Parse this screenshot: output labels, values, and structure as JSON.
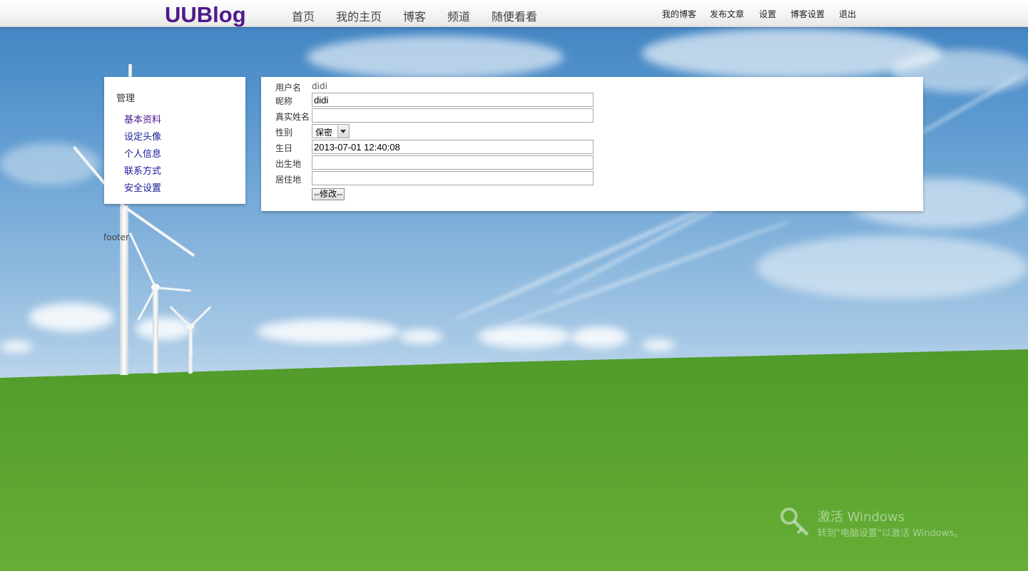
{
  "header": {
    "logo": "UUBlog",
    "main_nav": [
      "首页",
      "我的主页",
      "博客",
      "频道",
      "随便看看"
    ],
    "user_nav": [
      "我的博客",
      "发布文章",
      "设置",
      "博客设置",
      "退出"
    ]
  },
  "sidebar": {
    "title": "管理",
    "items": [
      "基本资料",
      "设定头像",
      "个人信息",
      "联系方式",
      "安全设置"
    ]
  },
  "form": {
    "username_label": "用户名",
    "username_value": "didi",
    "nickname_label": "昵称",
    "nickname_value": "didi",
    "realname_label": "真实姓名",
    "realname_value": "",
    "gender_label": "性别",
    "gender_selected": "保密",
    "birthday_label": "生日",
    "birthday_value": "2013-07-01 12:40:08",
    "birthplace_label": "出生地",
    "birthplace_value": "",
    "residence_label": "居住地",
    "residence_value": "",
    "submit_label": "--修改--"
  },
  "footer": {
    "text": "footer"
  },
  "watermark": {
    "line1": "激活 Windows",
    "line2": "转到\"电脑设置\"以激活 Windows。"
  },
  "colors": {
    "logo": "#4e1a8a",
    "link": "#1a1a9a",
    "link_visited": "#4e1a8a"
  }
}
